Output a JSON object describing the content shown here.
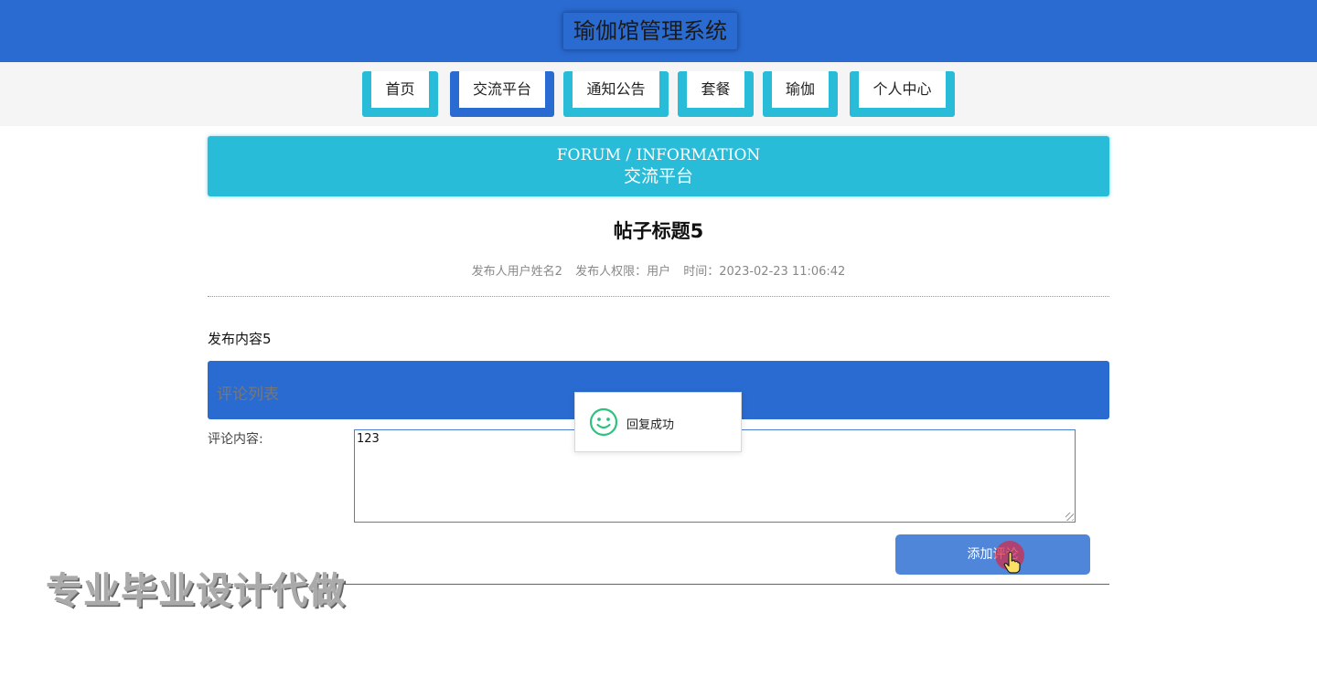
{
  "header": {
    "title": "瑜伽馆管理系统"
  },
  "nav": {
    "items": [
      {
        "label": "首页",
        "active": false
      },
      {
        "label": "交流平台",
        "active": true
      },
      {
        "label": "通知公告",
        "active": false
      },
      {
        "label": "套餐",
        "active": false
      },
      {
        "label": "瑜伽",
        "active": false
      },
      {
        "label": "个人中心",
        "active": false
      }
    ]
  },
  "banner": {
    "en": "FORUM / INFORMATION",
    "cn": "交流平台"
  },
  "post": {
    "title": "帖子标题5",
    "author": "发布人用户姓名2",
    "permission": "发布人权限：用户",
    "time": "时间：2023-02-23 11:06:42",
    "content": "发布内容5"
  },
  "comments": {
    "header": "评论列表",
    "label": "评论内容:",
    "value": "123",
    "add_button": "添加评论"
  },
  "toast": {
    "message": "回复成功",
    "icon": "smile-icon"
  },
  "watermark": "专业毕业设计代做",
  "colors": {
    "primary": "#2a6bd1",
    "accent": "#29bcd9",
    "button": "#4f86d9"
  }
}
